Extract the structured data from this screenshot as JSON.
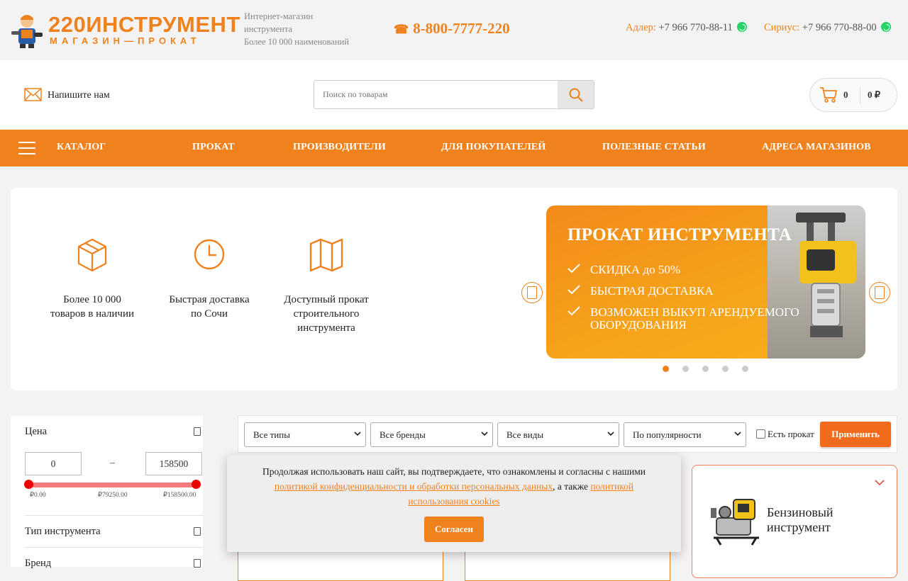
{
  "brand": {
    "logo_title": "220ИНСТРУМЕНТ",
    "logo_sub": "МАГАЗИН—ПРОКАТ",
    "tagline_1": "Интернет-магазин",
    "tagline_2": "инструмента",
    "tagline_3": "Более 10 000 наименований",
    "accent_color": "#f0821e"
  },
  "contacts": {
    "main_phone": "8-800-7777-220",
    "adler_label": "Адлер:",
    "adler_phone": "+7 966 770-88-11",
    "sirius_label": "Сириус:",
    "sirius_phone": "+7 966 770-88-00"
  },
  "header": {
    "write_us": "Напишите нам",
    "search_placeholder": "Поиск по товарам",
    "cart_count": "0",
    "cart_total": "0 ₽"
  },
  "nav": {
    "items": [
      "КАТАЛОГ",
      "ПРОКАТ",
      "ПРОИЗВОДИТЕЛИ",
      "ДЛЯ ПОКУПАТЕЛЕЙ",
      "ПОЛЕЗНЫЕ СТАТЬИ",
      "АДРЕСА МАГАЗИНОВ"
    ]
  },
  "features": [
    {
      "icon": "box-icon",
      "line1": "Более 10 000",
      "line2": "товаров в наличии",
      "line3": ""
    },
    {
      "icon": "clock-icon",
      "line1": "Быстрая доставка",
      "line2": "по Сочи",
      "line3": ""
    },
    {
      "icon": "map-icon",
      "line1": "Доступный прокат",
      "line2": "строительного",
      "line3": "инструмента"
    }
  ],
  "banner": {
    "title": "ПРОКАТ ИНСТРУМЕНТА",
    "bullets": [
      "СКИДКА до 50%",
      "БЫСТРАЯ ДОСТАВКА",
      "ВОЗМОЖЕН ВЫКУП АРЕНДУЕМОГО",
      "ОБОРУДОВАНИЯ"
    ],
    "slide_count": 5,
    "active_slide": 1
  },
  "filters": {
    "price_title": "Цена",
    "price_min": "0",
    "price_max": "158500",
    "price_range_low": "₽0.00",
    "price_range_mid": "₽79250.00",
    "price_range_high": "₽158500.00",
    "tool_type_title": "Тип инструмента",
    "brand_title": "Бренд"
  },
  "catalog_bar": {
    "types": "Все типы",
    "brands": "Все бренды",
    "kinds": "Все виды",
    "sort": "По популярности",
    "has_rent": "Есть прокат",
    "apply": "Применить"
  },
  "category_card": {
    "title_line1": "Бензиновый",
    "title_line2": "инструмент"
  },
  "cookie": {
    "text": "Продолжая использовать наш сайт, вы подтверждаете, что ознакомлены и согласны с нашими",
    "link1": "политикой конфиденциальности и обработки персональных данных",
    "mid": ", а также",
    "link2_line1": "политикой",
    "link2_line2": "использования cookies",
    "button": "Согласен"
  }
}
